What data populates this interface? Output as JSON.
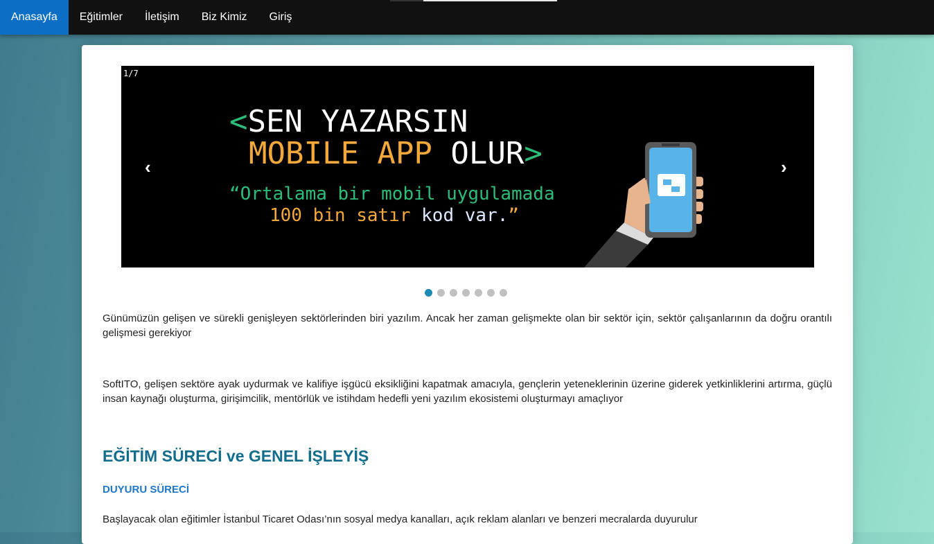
{
  "nav": {
    "items": [
      {
        "label": "Anasayfa",
        "active": true
      },
      {
        "label": "Eğitimler"
      },
      {
        "label": "İletişim"
      },
      {
        "label": "Biz Kimiz"
      },
      {
        "label": "Giriş"
      }
    ],
    "active_color": "#0d6ec5"
  },
  "slider": {
    "counter": "1/7",
    "prev_icon": "‹",
    "next_icon": "›",
    "headline": {
      "open_bracket": "<",
      "line1": "SEN YAZARSIN",
      "mobile_app": "MOBILE APP",
      "olur": " OLUR",
      "close_bracket": ">"
    },
    "quote": {
      "line1": "“Ortalama bir mobil uygulamada",
      "line2_a": "100 bin satır ",
      "line2_b": "kod var.",
      "line2_c": "”"
    },
    "total_slides": 7,
    "active_slide": 1
  },
  "content": {
    "paragraph1": "Günümüzün gelişen ve sürekli genişleyen sektörlerinden biri yazılım. Ancak her zaman gelişmekte olan bir sektör için, sektör çalışanlarının da doğru orantılı gelişmesi gerekiyor",
    "paragraph2": "SoftITO, gelişen sektöre ayak uydurmak ve kalifiye işgücü eksikliğini kapatmak amacıyla, gençlerin yeteneklerinin üzerine giderek yetkinliklerini artırma, güçlü insan kaynağı oluşturma, girişimcilik, mentörlük ve istihdam hedefli yeni yazılım ekosistemi oluşturmayı amaçlıyor",
    "section_title": "EĞİTİM SÜRECİ ve GENEL İŞLEYİŞ",
    "subsection_title": "DUYURU SÜRECİ",
    "paragraph3": "Başlayacak olan eğitimler İstanbul Ticaret Odası’nın sosyal medya kanalları, açık reklam alanları ve benzeri mecralarda duyurulur"
  },
  "colors": {
    "green": "#2dbd7a",
    "orange": "#f2a83b",
    "section_title": "#126d8c",
    "subsection_title": "#1f76c9"
  }
}
